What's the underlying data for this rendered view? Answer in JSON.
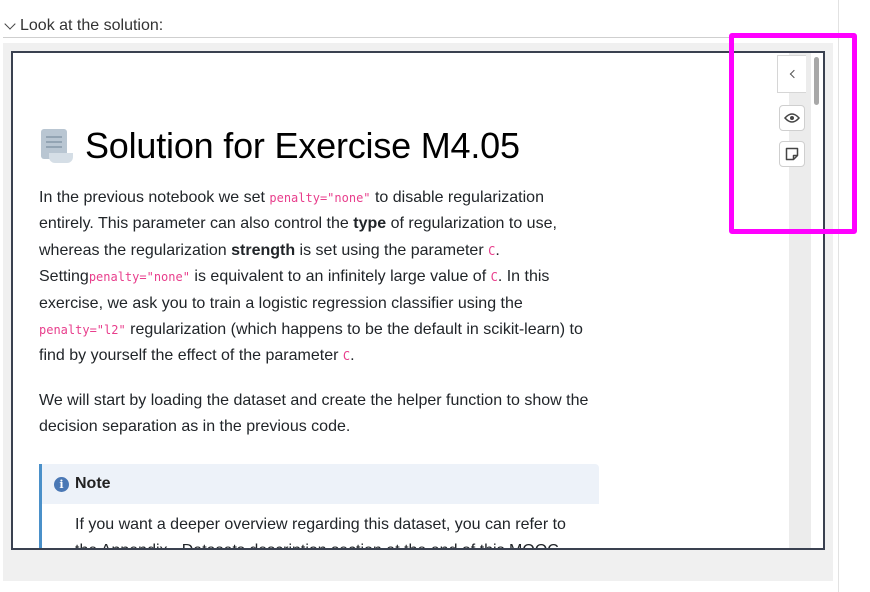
{
  "details": {
    "summary": "Look at the solution:"
  },
  "notebook": {
    "title": "Solution for Exercise M4.05",
    "paragraph1": {
      "t1": "In the previous notebook we set ",
      "c1": "penalty=\"none\"",
      "t2": " to disable regularization entirely. This parameter can also control the ",
      "b1": "type",
      "t3": " of regularization to use, whereas the regularization ",
      "b2": "strength",
      "t4": " is set using the parameter ",
      "c2": "C",
      "t5": ". Setting",
      "c3": "penalty=\"none\"",
      "t6": " is equivalent to an infinitely large value of ",
      "c4": "C",
      "t7": ". In this exercise, we ask you to train a logistic regression classifier using the ",
      "c5": "penalty=\"l2\"",
      "t8": " regularization (which happens to be the default in scikit-learn) to find by yourself the effect of the parameter ",
      "c6": "C",
      "t9": "."
    },
    "paragraph2": "We will start by loading the dataset and create the helper function to show the decision separation as in the previous code.",
    "note": {
      "title": "Note",
      "body": "If you want a deeper overview regarding this dataset, you can refer to the Appendix - Datasets description section at the end of this MOOC."
    }
  },
  "sidebar": {
    "toggle_icon": "chevron-left-icon",
    "tools": [
      {
        "icon": "eye-icon"
      },
      {
        "icon": "sticky-note-icon"
      }
    ]
  },
  "colors": {
    "highlight": "#ff00ff",
    "code": "#e83e8c",
    "note_border": "#4a90c9",
    "frame_border": "#3a4150"
  }
}
